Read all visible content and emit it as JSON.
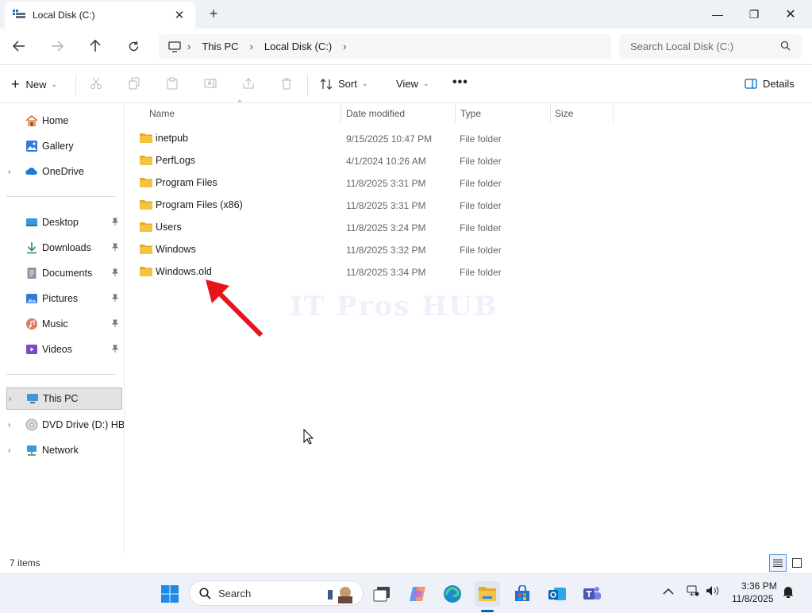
{
  "window": {
    "tab_title": "Local Disk (C:)",
    "tab_close": "✕",
    "new_tab": "+",
    "minimize": "—",
    "maximize": "❐",
    "close": "✕"
  },
  "address": {
    "breadcrumbs": [
      "This PC",
      "Local Disk (C:)"
    ],
    "separator": "›",
    "search_placeholder": "Search Local Disk (C:)"
  },
  "toolbar": {
    "new_label": "New",
    "sort_label": "Sort",
    "view_label": "View",
    "more_label": "•••",
    "details_label": "Details",
    "chevron": "⌄"
  },
  "sidebar": {
    "items": [
      {
        "label": "Home",
        "icon": "home-icon"
      },
      {
        "label": "Gallery",
        "icon": "gallery-icon"
      },
      {
        "label": "OneDrive",
        "icon": "onedrive-icon"
      },
      {
        "label": "Desktop",
        "icon": "desktop-icon"
      },
      {
        "label": "Downloads",
        "icon": "downloads-icon"
      },
      {
        "label": "Documents",
        "icon": "documents-icon"
      },
      {
        "label": "Pictures",
        "icon": "pictures-icon"
      },
      {
        "label": "Music",
        "icon": "music-icon"
      },
      {
        "label": "Videos",
        "icon": "videos-icon"
      },
      {
        "label": "This PC",
        "icon": "this-pc-icon"
      },
      {
        "label": "DVD Drive (D:) HBC",
        "icon": "dvd-drive-icon"
      },
      {
        "label": "Network",
        "icon": "network-icon"
      }
    ],
    "expander": "›",
    "pin": "📌"
  },
  "columns": {
    "name": "Name",
    "date": "Date modified",
    "type": "Type",
    "size": "Size"
  },
  "files": [
    {
      "name": "inetpub",
      "date": "9/15/2025 10:47 PM",
      "type": "File folder"
    },
    {
      "name": "PerfLogs",
      "date": "4/1/2024 10:26 AM",
      "type": "File folder"
    },
    {
      "name": "Program Files",
      "date": "11/8/2025 3:31 PM",
      "type": "File folder"
    },
    {
      "name": "Program Files (x86)",
      "date": "11/8/2025 3:31 PM",
      "type": "File folder"
    },
    {
      "name": "Users",
      "date": "11/8/2025 3:24 PM",
      "type": "File folder"
    },
    {
      "name": "Windows",
      "date": "11/8/2025 3:32 PM",
      "type": "File folder"
    },
    {
      "name": "Windows.old",
      "date": "11/8/2025 3:34 PM",
      "type": "File folder"
    }
  ],
  "watermark": "IT Pros HUB",
  "status": {
    "item_count": "7 items"
  },
  "taskbar": {
    "search_label": "Search",
    "time": "3:36 PM",
    "date": "11/8/2025"
  },
  "colors": {
    "folder": "#f5c342",
    "accent": "#0067c0",
    "annotation_arrow": "#e8141b"
  }
}
